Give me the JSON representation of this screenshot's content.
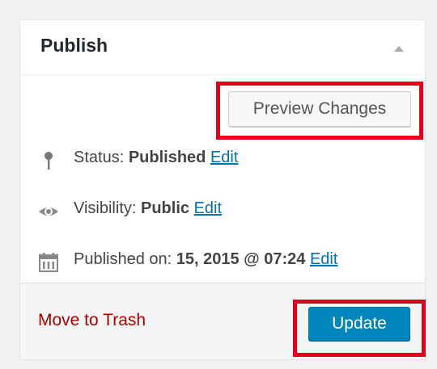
{
  "panel": {
    "title": "Publish",
    "toggle_icon": "triangle-up-icon"
  },
  "actions": {
    "preview_label": "Preview Changes"
  },
  "status": {
    "icon": "pin-icon",
    "label": "Status: ",
    "value": "Published",
    "edit_label": "Edit"
  },
  "visibility": {
    "icon": "eye-icon",
    "label": "Visibility: ",
    "value": "Public",
    "edit_label": "Edit"
  },
  "published": {
    "icon": "calendar-icon",
    "label": "Published on: ",
    "value": "15, 2015 @ 07:24",
    "edit_label": "Edit"
  },
  "footer": {
    "trash_label": "Move to Trash",
    "update_label": "Update"
  },
  "colors": {
    "primary_button": "#0085ba",
    "highlight": "#e3001b",
    "link": "#0073aa",
    "trash": "#a00"
  }
}
